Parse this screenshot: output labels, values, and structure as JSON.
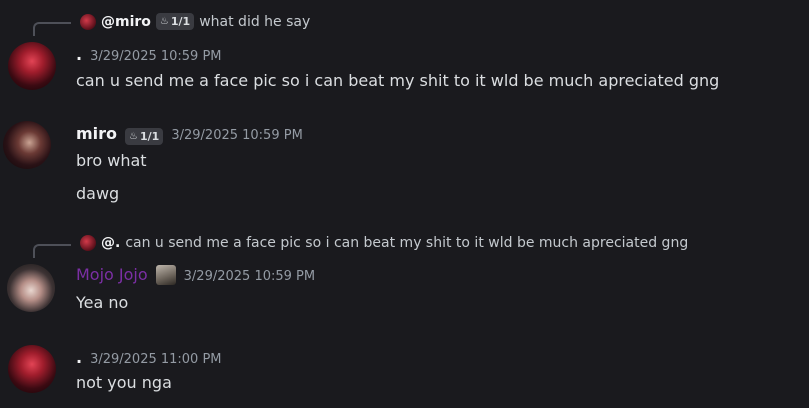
{
  "messages": [
    {
      "reply": {
        "author": "@miro",
        "badge": "1/1",
        "text": "what did he say"
      },
      "author": ".",
      "timestamp": "3/29/2025 10:59 PM",
      "lines": [
        "can u send me a face pic so i can beat my shit to it wld be much apreciated gng"
      ]
    },
    {
      "author": "miro",
      "badge": "1/1",
      "timestamp": "3/29/2025 10:59 PM",
      "lines": [
        "bro what",
        "dawg"
      ]
    },
    {
      "reply": {
        "author": "@.",
        "text": "can u send me a face pic so i can beat my shit to it wld be much apreciated gng"
      },
      "author": "Mojo Jojo",
      "author_color": "#7b2fa4",
      "timestamp": "3/29/2025 10:59 PM",
      "lines": [
        "Yea no"
      ]
    },
    {
      "author": ".",
      "timestamp": "3/29/2025 11:00 PM",
      "lines": [
        "not you nga"
      ]
    }
  ]
}
